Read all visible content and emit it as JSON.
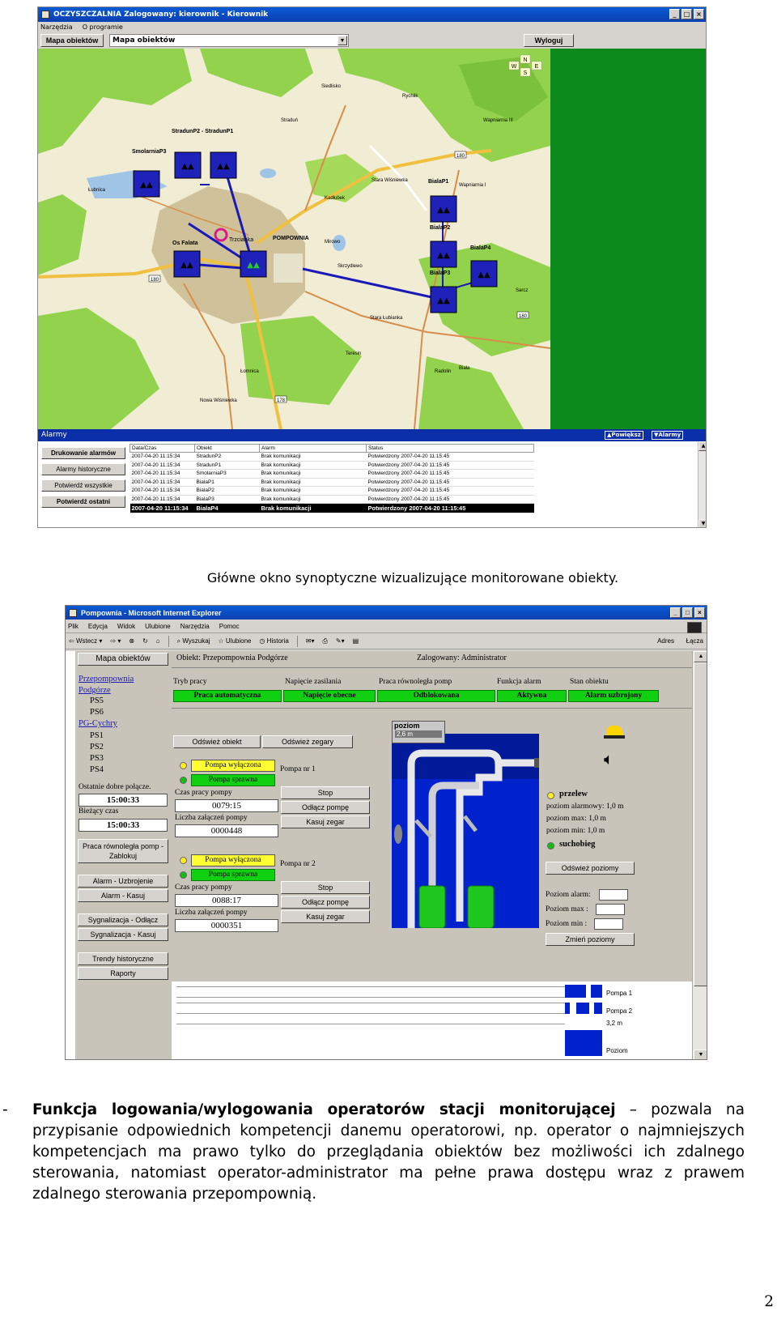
{
  "window1": {
    "title": "OCZYSZCZALNIA  Zalogowany: kierownik - Kierownik",
    "menu": [
      "Narzędzia",
      "O programie"
    ],
    "map_button": "Mapa obiektów",
    "map_select": "Mapa obiektów",
    "logout": "Wyloguj",
    "compass": [
      "N",
      "W",
      "S",
      "E"
    ],
    "map_labels": {
      "stations": [
        "StradunP2 - StradunP1",
        "SmolarniaP3",
        "Os Falata",
        "BialaP1",
        "BialaP2",
        "BialaP3",
        "BialaP4"
      ],
      "towns": [
        "POMPOWNIA",
        "Trzcianka",
        "Stara Wiśniewka",
        "Biała",
        "Straduń",
        "Wapniarnia I",
        "Nowa Wiśniewka",
        "Sarcz",
        "Radolin",
        "Teresin",
        "Łomnica",
        "Siedlisko",
        "Rychlik",
        "Łubnica",
        "Kadłubek",
        "Mirowo",
        "Wapniarnia III",
        "Skrzydlewo",
        "Stara Łubianka"
      ],
      "roads": [
        "180",
        "180",
        "180",
        "178",
        "180"
      ]
    },
    "alarms": {
      "title": "Alarmy",
      "btn_prev": "▲Powiększ",
      "btn_alarm": "▼Alarmy",
      "buttons": [
        "Drukowanie alarmów",
        "Alarmy historyczne",
        "Potwierdź wszystkie",
        "Potwierdź ostatni"
      ],
      "columns": [
        "Data/Czas",
        "Obiekt",
        "Alarm",
        "Status"
      ],
      "rows": [
        [
          "2007-04-20 11:15:34",
          "StradunP2",
          "Brak komunikacji",
          "Potwierdzony 2007-04-20 11:15:45"
        ],
        [
          "2007-04-20 11:15:34",
          "StradunP1",
          "Brak komunikacji",
          "Potwierdzony 2007-04-20 11:15:45"
        ],
        [
          "2007-04-20 11:15:34",
          "SmolarniaP3",
          "Brak komunikacji",
          "Potwierdzony 2007-04-20 11:15:45"
        ],
        [
          "2007-04-20 11:15:34",
          "BialaP1",
          "Brak komunikacji",
          "Potwierdzony 2007-04-20 11:15:45"
        ],
        [
          "2007-04-20 11:15:34",
          "BialaP2",
          "Brak komunikacji",
          "Potwierdzony 2007-04-20 11:15:45"
        ],
        [
          "2007-04-20 11:15:34",
          "BialaP3",
          "Brak komunikacji",
          "Potwierdzony 2007-04-20 11:15:45"
        ],
        [
          "2007-04-20 11:15:34",
          "BialaP4",
          "Brak komunikacji",
          "Potwierdzony 2007-04-20 11:15:45"
        ]
      ]
    }
  },
  "caption1": "Główne okno synoptyczne wizualizujące monitorowane obiekty.",
  "window2": {
    "title": "Pompownia - Microsoft Internet Explorer",
    "menu": [
      "Plik",
      "Edycja",
      "Widok",
      "Ulubione",
      "Narzędzia",
      "Pomoc"
    ],
    "toolbar": [
      "Wstecz",
      "Wyszukaj",
      "Ulubione",
      "Historia"
    ],
    "adres": "Adres",
    "lacza": "Łącza",
    "nav": {
      "map_button": "Mapa obiektów",
      "links": [
        "Przepompownia Podgórze"
      ],
      "podgorze_subs": [
        "PS5",
        "PS6"
      ],
      "link2": "PG-Cychry",
      "cychry_subs": [
        "PS1",
        "PS2",
        "PS3",
        "PS4"
      ],
      "last_conn_label": "Ostatnie dobre połącze.",
      "last_conn": "15:00:33",
      "cur_time_label": "Bieżący czas",
      "cur_time": "15:00:33",
      "buttons": [
        "Praca równoległa pomp - Zablokuj",
        "Alarm - Uzbrojenie",
        "Alarm - Kasuj",
        "Sygnalizacja - Odłącz",
        "Sygnalizacja - Kasuj",
        "Trendy historyczne",
        "Raporty"
      ]
    },
    "header": {
      "object": "Obiekt: Przepompownia Podgórze",
      "logged": "Zalogowany: Administrator"
    },
    "status": [
      {
        "label": "Tryb pracy",
        "value": "Praca automatyczna"
      },
      {
        "label": "Napięcie zasilania",
        "value": "Napięcie obecne"
      },
      {
        "label": "Praca równoległa pomp",
        "value": "Odblokowana"
      },
      {
        "label": "Funkcja alarm",
        "value": "Aktywna"
      },
      {
        "label": "Stan obiektu",
        "value": "Alarm uzbrojony"
      }
    ],
    "refresh_obj": "Odśwież obiekt",
    "refresh_clock": "Odśwież zegary",
    "pumps": [
      {
        "state1": "Pompa wyłączona",
        "state2": "Pompa sprawna",
        "name": "Pompa nr 1",
        "runtime_label": "Czas pracy pompy",
        "runtime": "0079:15",
        "count_label": "Liczba załączeń pompy",
        "count": "0000448",
        "stop": "Stop",
        "disconnect": "Odłącz pompę",
        "reset": "Kasuj zegar"
      },
      {
        "state1": "Pompa wyłączona",
        "state2": "Pompa sprawna",
        "name": "Pompa nr 2",
        "runtime_label": "Czas pracy pompy",
        "runtime": "0088:17",
        "count_label": "Liczba załączeń pompy",
        "count": "0000351",
        "stop": "Stop",
        "disconnect": "Odłącz pompę",
        "reset": "Kasuj zegar"
      }
    ],
    "tank": {
      "label": "poziom",
      "value": "2,6 m"
    },
    "levels": {
      "overflow": "przelew",
      "alarm": "poziom alarmowy: 1,0 m",
      "max": "poziom max: 1,0 m",
      "min": "poziom min: 1,0 m",
      "dry": "suchobieg",
      "refresh": "Odśwież poziomy",
      "alarm_in": "Poziom alarm:",
      "max_in": "Poziom max :",
      "min_in": "Poziom min :",
      "change": "Zmień poziomy"
    },
    "trend_labels": [
      "Pompa 1",
      "Pompa 2",
      "3,2 m",
      "Poziom"
    ]
  },
  "paragraph": {
    "dash": "-",
    "bold": "Funkcja logowania/wylogowania operatorów stacji monitorującej",
    "rest": " – pozwala na przypisanie odpowiednich kompetencji danemu operatorowi, np. operator o najmniejszych kompetencjach ma prawo tylko do przeglądania obiektów bez możliwości ich zdalnego sterowania, natomiast operator-administrator ma pełne prawa dostępu wraz z prawem zdalnego sterowania przepompownią."
  },
  "page_number": "2",
  "colors": {
    "title_blue": "#0a4fc8",
    "map_green": "#8fd04a",
    "panel_green": "#0c8a1c",
    "tank_blue": "#0022cc",
    "status_green": "#11d011"
  }
}
